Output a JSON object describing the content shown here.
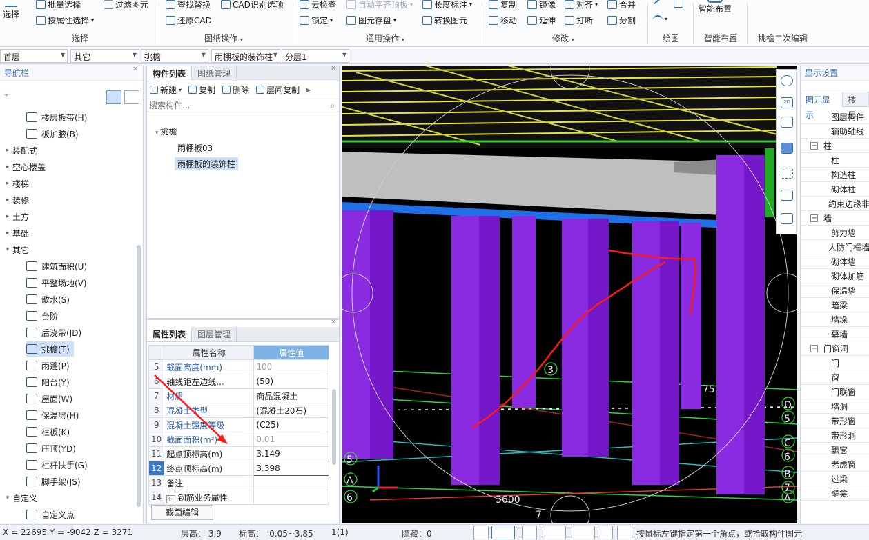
{
  "ribbon": {
    "select": {
      "big": "选择",
      "batch": "批量选择",
      "filter": "过滤图元",
      "by_attr": "按属性选择",
      "group": "选择"
    },
    "drawing": {
      "find_replace": "查找替换",
      "cad_recog": "CAD识别选项",
      "restore_cad": "还原CAD",
      "group": "图纸操作"
    },
    "common": {
      "cloud_check": "云检查",
      "auto_align": "自动平齐顶板",
      "lock": "锁定",
      "store_elem": "图元存盘",
      "length_mark": "长度标注",
      "convert_elem": "转换图元",
      "group": "通用操作"
    },
    "modify": {
      "copy": "复制",
      "mirror": "镜像",
      "align": "对齐",
      "merge": "合并",
      "move": "移动",
      "extend": "延伸",
      "break": "打断",
      "split": "分割",
      "group": "修改"
    },
    "draw": {
      "group": "绘图"
    },
    "smart": {
      "big": "智能布置",
      "group": "智能布置"
    },
    "edit2": {
      "group": "挑檐二次编辑"
    }
  },
  "selectors": {
    "floor": "首层",
    "category": "其它",
    "type": "挑檐",
    "component": "雨棚板的装饰柱",
    "layer": "分层1"
  },
  "nav": {
    "title": "导航栏",
    "items": [
      {
        "label": "楼层板带(H)",
        "kind": "child"
      },
      {
        "label": "板加腋(B)",
        "kind": "child"
      },
      {
        "label": "装配式",
        "kind": "group"
      },
      {
        "label": "空心楼盖",
        "kind": "group"
      },
      {
        "label": "楼梯",
        "kind": "group"
      },
      {
        "label": "装修",
        "kind": "group"
      },
      {
        "label": "土方",
        "kind": "group"
      },
      {
        "label": "基础",
        "kind": "group"
      },
      {
        "label": "其它",
        "kind": "open"
      },
      {
        "label": "建筑面积(U)",
        "kind": "child"
      },
      {
        "label": "平整场地(V)",
        "kind": "child"
      },
      {
        "label": "散水(S)",
        "kind": "child"
      },
      {
        "label": "台阶",
        "kind": "child"
      },
      {
        "label": "后浇带(JD)",
        "kind": "child"
      },
      {
        "label": "挑檐(T)",
        "kind": "selected"
      },
      {
        "label": "雨蓬(P)",
        "kind": "child"
      },
      {
        "label": "阳台(Y)",
        "kind": "child"
      },
      {
        "label": "屋面(W)",
        "kind": "child"
      },
      {
        "label": "保温层(H)",
        "kind": "child"
      },
      {
        "label": "栏板(K)",
        "kind": "child"
      },
      {
        "label": "压顶(YD)",
        "kind": "child"
      },
      {
        "label": "栏杆扶手(G)",
        "kind": "child"
      },
      {
        "label": "脚手架(JS)",
        "kind": "child"
      },
      {
        "label": "自定义",
        "kind": "open"
      },
      {
        "label": "自定义点",
        "kind": "child"
      }
    ]
  },
  "component_list": {
    "tabs": [
      "构件列表",
      "图纸管理"
    ],
    "toolbar": {
      "new": "新建",
      "copy": "复制",
      "delete": "删除",
      "floor_copy": "层间复制"
    },
    "search_placeholder": "搜索构件...",
    "tree_root": "挑檐",
    "items": [
      "雨棚板03",
      "雨棚板的装饰柱"
    ]
  },
  "properties": {
    "tabs": [
      "属性列表",
      "图层管理"
    ],
    "header": [
      "属性名称",
      "属性值"
    ],
    "rows": [
      {
        "n": "5",
        "name": "截面高度(mm)",
        "value": "100",
        "style": "blue-gray"
      },
      {
        "n": "6",
        "name": "轴线距左边线...",
        "value": "(50)",
        "style": ""
      },
      {
        "n": "7",
        "name": "材质",
        "value": "商品混凝土",
        "style": "blue"
      },
      {
        "n": "8",
        "name": "混凝土类型",
        "value": "(混凝土20石)",
        "style": "blue"
      },
      {
        "n": "9",
        "name": "混凝土强度等级",
        "value": "(C25)",
        "style": "blue"
      },
      {
        "n": "10",
        "name": "截面面积(m²)",
        "value": "0.01",
        "style": "blue-gray"
      },
      {
        "n": "11",
        "name": "起点顶标高(m)",
        "value": "3.149",
        "style": ""
      },
      {
        "n": "12",
        "name": "终点顶标高(m)",
        "value": "3.398",
        "style": "current"
      },
      {
        "n": "13",
        "name": "备注",
        "value": "",
        "style": ""
      },
      {
        "n": "14",
        "name": "钢筋业务属性",
        "value": "",
        "style": "expand"
      }
    ],
    "edit_button": "截面编辑"
  },
  "viewport": {
    "labels": [
      "3",
      "75",
      "3600",
      "7",
      "D",
      "5",
      "C",
      "6",
      "B",
      "7",
      "A",
      "5",
      "A",
      "6"
    ]
  },
  "display": {
    "title": "显示设置",
    "tabs": [
      "图元显示",
      "楼层"
    ],
    "rows": [
      {
        "label": "图层构件",
        "kind": "item"
      },
      {
        "label": "辅助轴线",
        "kind": "item"
      },
      {
        "label": "柱",
        "kind": "group"
      },
      {
        "label": "柱",
        "kind": "item"
      },
      {
        "label": "构造柱",
        "kind": "item"
      },
      {
        "label": "砌体柱",
        "kind": "item"
      },
      {
        "label": "约束边缘非",
        "kind": "item"
      },
      {
        "label": "墙",
        "kind": "group"
      },
      {
        "label": "剪力墙",
        "kind": "item"
      },
      {
        "label": "人防门框墙",
        "kind": "item"
      },
      {
        "label": "砌体墙",
        "kind": "item"
      },
      {
        "label": "砌体加筋",
        "kind": "item"
      },
      {
        "label": "保温墙",
        "kind": "item"
      },
      {
        "label": "暗梁",
        "kind": "item"
      },
      {
        "label": "墙垛",
        "kind": "item"
      },
      {
        "label": "幕墙",
        "kind": "item"
      },
      {
        "label": "门窗洞",
        "kind": "group"
      },
      {
        "label": "门",
        "kind": "item"
      },
      {
        "label": "窗",
        "kind": "item"
      },
      {
        "label": "门联窗",
        "kind": "item"
      },
      {
        "label": "墙洞",
        "kind": "item"
      },
      {
        "label": "带形窗",
        "kind": "item"
      },
      {
        "label": "带形洞",
        "kind": "item"
      },
      {
        "label": "飘窗",
        "kind": "item"
      },
      {
        "label": "老虎窗",
        "kind": "item"
      },
      {
        "label": "过梁",
        "kind": "item"
      },
      {
        "label": "壁龛",
        "kind": "item"
      }
    ]
  },
  "status": {
    "coords": "X = 22695 Y = -9042 Z = 3271",
    "floor_height": "层高： 3.9",
    "elevation": "标高： -0.05~3.85",
    "count": "1(1)",
    "hidden": "隐藏：0",
    "hint": "按鼠标左键指定第一个角点，或拾取构件图元"
  },
  "colors": {
    "accent": "#2d6fb8",
    "selected_bg": "#cfe1f7",
    "header_value": "#7fb3e8",
    "column": "#8a2be2",
    "annotation": "#ff1a1a"
  }
}
